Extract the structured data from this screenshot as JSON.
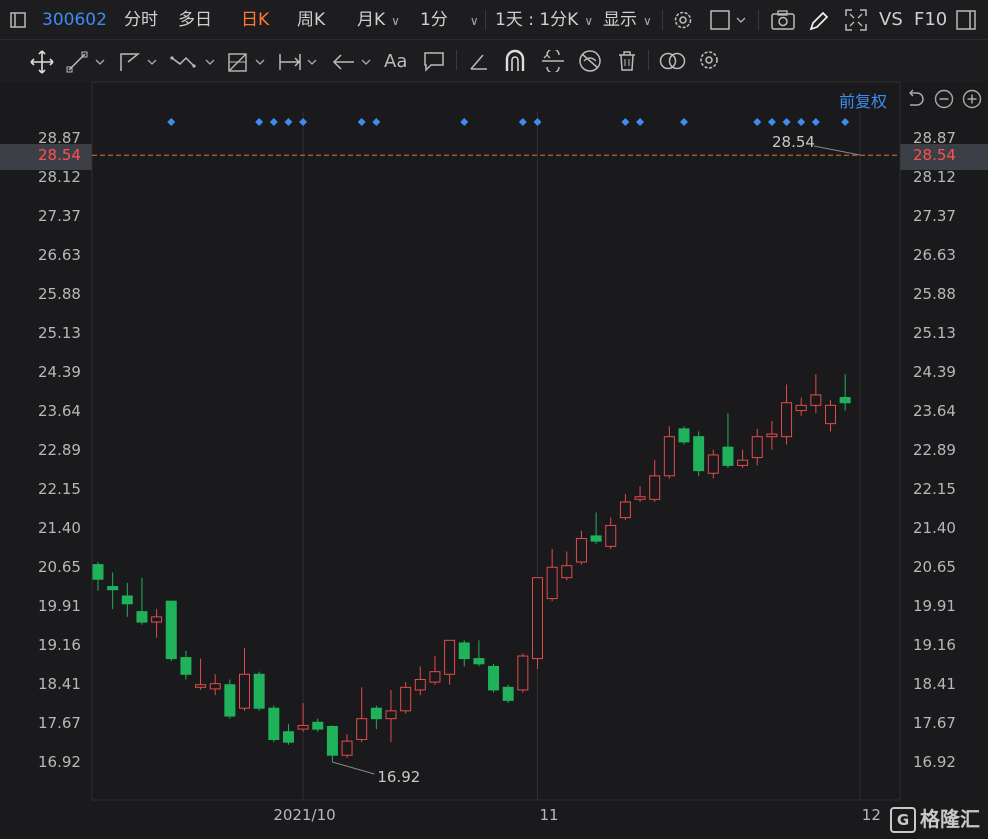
{
  "toolbar": {
    "stock_code": "300602",
    "tabs": [
      {
        "label": "分时",
        "active": false
      },
      {
        "label": "多日",
        "active": false
      },
      {
        "label": "日K",
        "active": true
      },
      {
        "label": "周K",
        "active": false
      },
      {
        "label": "月K",
        "active": false
      },
      {
        "label": "1分",
        "active": false
      }
    ],
    "period_select": "1天 : 1分K",
    "display_label": "显示",
    "vs_label": "VS",
    "f10_label": "F10"
  },
  "drawing_tools": [
    "move-tool",
    "line-tool",
    "channel-tool",
    "wave-tool",
    "fib-tool",
    "measure-tool",
    "arrow-tool",
    "text-tool",
    "comment-tool",
    "eraser-tool",
    "magnet-tool",
    "link-tool",
    "hide-tool",
    "delete-tool",
    "overlay-tool",
    "settings-tool"
  ],
  "chart_controls": {
    "restore_label": "前复权"
  },
  "colors": {
    "up": "#e24b4b",
    "down": "#1fb25a",
    "accent": "#3d8cf0",
    "active_tab": "#ff7a2d",
    "price_line": "#e0703a"
  },
  "chart_data": {
    "type": "candlestick",
    "title": "",
    "y_ticks": [
      "28.87",
      "28.12",
      "27.37",
      "26.63",
      "25.88",
      "25.13",
      "24.39",
      "23.64",
      "22.89",
      "22.15",
      "21.40",
      "20.65",
      "19.91",
      "19.16",
      "18.41",
      "17.67",
      "16.92"
    ],
    "ylim": [
      16.5,
      29.2
    ],
    "x_labels": [
      {
        "label": "2021/10",
        "index": 14
      },
      {
        "label": "11",
        "index": 30
      },
      {
        "label": "12",
        "index": 52
      }
    ],
    "current_price": "28.54",
    "current_price_annotation": "28.54",
    "min_annotation": "16.92",
    "event_markers": [
      5,
      11,
      12,
      13,
      14,
      18,
      19,
      25,
      29,
      30,
      36,
      37,
      40,
      45,
      46,
      47,
      48,
      49,
      51
    ],
    "candles": [
      {
        "o": 20.7,
        "c": 20.42,
        "h": 20.75,
        "l": 20.2
      },
      {
        "o": 20.28,
        "c": 20.22,
        "h": 20.55,
        "l": 19.85
      },
      {
        "o": 20.1,
        "c": 19.95,
        "h": 20.35,
        "l": 19.7
      },
      {
        "o": 19.8,
        "c": 19.6,
        "h": 20.45,
        "l": 19.55
      },
      {
        "o": 19.6,
        "c": 19.7,
        "h": 19.85,
        "l": 19.3
      },
      {
        "o": 20.0,
        "c": 18.9,
        "h": 20.0,
        "l": 18.85
      },
      {
        "o": 18.92,
        "c": 18.6,
        "h": 19.05,
        "l": 18.5
      },
      {
        "o": 18.35,
        "c": 18.4,
        "h": 18.9,
        "l": 18.3
      },
      {
        "o": 18.32,
        "c": 18.42,
        "h": 18.6,
        "l": 18.2
      },
      {
        "o": 18.4,
        "c": 17.8,
        "h": 18.5,
        "l": 17.75
      },
      {
        "o": 17.95,
        "c": 18.6,
        "h": 19.1,
        "l": 17.9
      },
      {
        "o": 18.6,
        "c": 17.95,
        "h": 18.65,
        "l": 17.9
      },
      {
        "o": 17.95,
        "c": 17.35,
        "h": 18.0,
        "l": 17.3
      },
      {
        "o": 17.5,
        "c": 17.3,
        "h": 17.65,
        "l": 17.25
      },
      {
        "o": 17.55,
        "c": 17.62,
        "h": 18.05,
        "l": 17.5
      },
      {
        "o": 17.68,
        "c": 17.55,
        "h": 17.75,
        "l": 17.5
      },
      {
        "o": 17.6,
        "c": 17.05,
        "h": 17.62,
        "l": 16.92
      },
      {
        "o": 17.05,
        "c": 17.32,
        "h": 17.45,
        "l": 17.0
      },
      {
        "o": 17.35,
        "c": 17.75,
        "h": 18.35,
        "l": 17.3
      },
      {
        "o": 17.95,
        "c": 17.75,
        "h": 18.0,
        "l": 17.55
      },
      {
        "o": 17.75,
        "c": 17.9,
        "h": 18.3,
        "l": 17.3
      },
      {
        "o": 17.9,
        "c": 18.35,
        "h": 18.45,
        "l": 17.85
      },
      {
        "o": 18.3,
        "c": 18.5,
        "h": 18.75,
        "l": 18.2
      },
      {
        "o": 18.45,
        "c": 18.65,
        "h": 18.95,
        "l": 18.4
      },
      {
        "o": 18.6,
        "c": 19.25,
        "h": 19.25,
        "l": 18.4
      },
      {
        "o": 19.2,
        "c": 18.9,
        "h": 19.25,
        "l": 18.75
      },
      {
        "o": 18.9,
        "c": 18.8,
        "h": 19.25,
        "l": 18.75
      },
      {
        "o": 18.75,
        "c": 18.3,
        "h": 18.8,
        "l": 18.25
      },
      {
        "o": 18.35,
        "c": 18.1,
        "h": 18.4,
        "l": 18.05
      },
      {
        "o": 18.3,
        "c": 18.95,
        "h": 19.0,
        "l": 18.25
      },
      {
        "o": 18.9,
        "c": 20.45,
        "h": 20.45,
        "l": 18.7
      },
      {
        "o": 20.05,
        "c": 20.65,
        "h": 21.0,
        "l": 20.0
      },
      {
        "o": 20.45,
        "c": 20.68,
        "h": 20.95,
        "l": 20.4
      },
      {
        "o": 20.75,
        "c": 21.2,
        "h": 21.35,
        "l": 20.7
      },
      {
        "o": 21.25,
        "c": 21.15,
        "h": 21.7,
        "l": 21.1
      },
      {
        "o": 21.05,
        "c": 21.45,
        "h": 21.6,
        "l": 21.0
      },
      {
        "o": 21.6,
        "c": 21.9,
        "h": 22.05,
        "l": 21.55
      },
      {
        "o": 21.95,
        "c": 22.0,
        "h": 22.2,
        "l": 21.9
      },
      {
        "o": 21.95,
        "c": 22.4,
        "h": 22.7,
        "l": 21.9
      },
      {
        "o": 22.4,
        "c": 23.15,
        "h": 23.35,
        "l": 22.35
      },
      {
        "o": 23.3,
        "c": 23.05,
        "h": 23.35,
        "l": 23.0
      },
      {
        "o": 23.15,
        "c": 22.5,
        "h": 23.25,
        "l": 22.4
      },
      {
        "o": 22.45,
        "c": 22.8,
        "h": 22.9,
        "l": 22.35
      },
      {
        "o": 22.95,
        "c": 22.6,
        "h": 23.6,
        "l": 22.55
      },
      {
        "o": 22.6,
        "c": 22.7,
        "h": 22.9,
        "l": 22.55
      },
      {
        "o": 22.75,
        "c": 23.15,
        "h": 23.3,
        "l": 22.6
      },
      {
        "o": 23.15,
        "c": 23.2,
        "h": 23.45,
        "l": 22.9
      },
      {
        "o": 23.15,
        "c": 23.8,
        "h": 24.15,
        "l": 23.0
      },
      {
        "o": 23.65,
        "c": 23.75,
        "h": 23.9,
        "l": 23.55
      },
      {
        "o": 23.75,
        "c": 23.95,
        "h": 24.35,
        "l": 23.6
      },
      {
        "o": 23.4,
        "c": 23.75,
        "h": 23.85,
        "l": 23.25
      },
      {
        "o": 23.9,
        "c": 23.8,
        "h": 24.35,
        "l": 23.65
      }
    ]
  },
  "watermark": "格隆汇"
}
